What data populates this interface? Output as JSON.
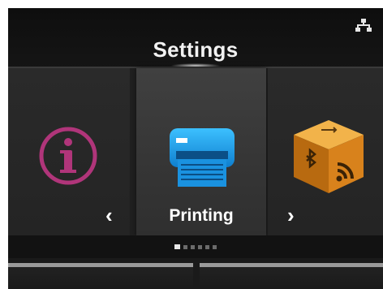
{
  "header": {
    "title": "Settings",
    "network_icon": "network-icon"
  },
  "carousel": {
    "items": [
      {
        "name": "info",
        "icon": "info-icon",
        "color": "#b0357a"
      },
      {
        "name": "printing",
        "label": "Printing",
        "icon": "printer-icon",
        "color": "#1e9ee8",
        "selected": true
      },
      {
        "name": "interface",
        "icon": "interface-cube-icon",
        "color": "#e08a1a"
      }
    ],
    "prev_arrow": "‹",
    "next_arrow": "›"
  },
  "pagination": {
    "total": 6,
    "active": 1
  },
  "colors": {
    "background": "#1b1b1b",
    "accent_blue": "#1e9ee8",
    "accent_orange": "#e08a1a",
    "accent_magenta": "#b0357a"
  }
}
